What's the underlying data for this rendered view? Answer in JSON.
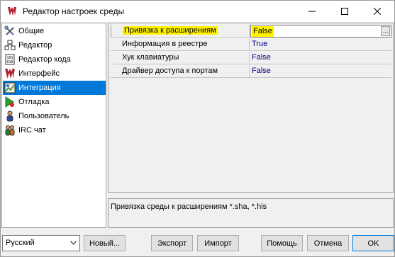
{
  "window": {
    "title": "Редактор настроек среды"
  },
  "nav": {
    "items": [
      {
        "label": "Общие",
        "icon": "wrench-screwdriver-icon"
      },
      {
        "label": "Редактор",
        "icon": "editor-icon"
      },
      {
        "label": "Редактор кода",
        "icon": "code-editor-icon"
      },
      {
        "label": "Интерфейс",
        "icon": "interface-logo-icon"
      },
      {
        "label": "Интеграция",
        "icon": "integration-icon"
      },
      {
        "label": "Отладка",
        "icon": "debug-icon"
      },
      {
        "label": "Пользователь",
        "icon": "user-icon"
      },
      {
        "label": "IRC чат",
        "icon": "irc-chat-icon"
      }
    ],
    "selected": "Интеграция"
  },
  "properties": [
    {
      "name": "Привязка к расширениям",
      "value": "False"
    },
    {
      "name": "Информация в реестре",
      "value": "True"
    },
    {
      "name": "Хук клавиатуры",
      "value": "False"
    },
    {
      "name": "Драйвер доступа к портам",
      "value": "False"
    }
  ],
  "description": "Привязка среды к расширениям *.sha, *.his",
  "footer": {
    "language": "Русский",
    "new_label": "Новый...",
    "export_label": "Экспорт",
    "import_label": "Импорт",
    "help_label": "Помощь",
    "cancel_label": "Отмена",
    "ok_label": "OK"
  },
  "colors": {
    "selection": "#0078d7",
    "highlight": "#fff200",
    "value_text": "#000080"
  }
}
